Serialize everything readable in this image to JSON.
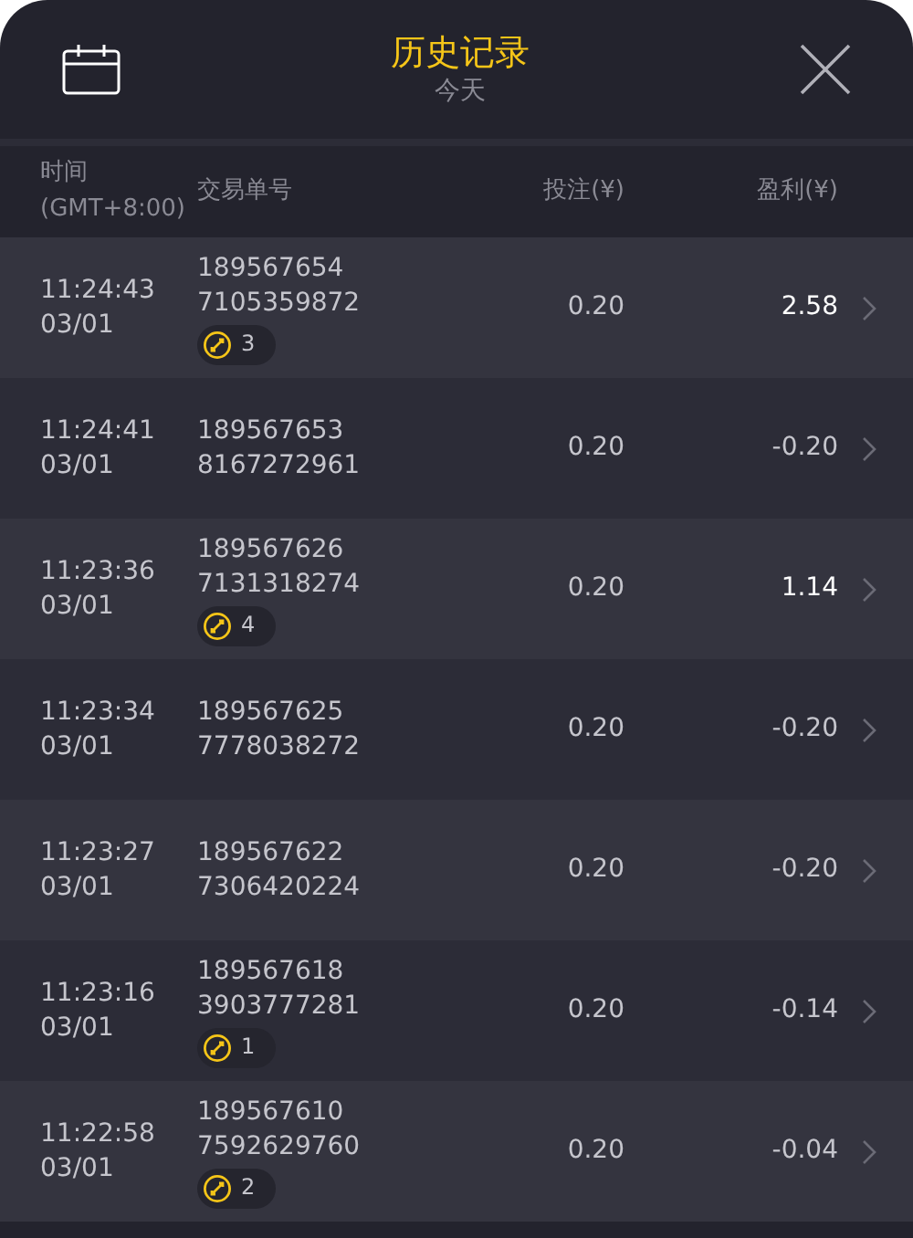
{
  "header": {
    "title": "历史记录",
    "subtitle": "今天"
  },
  "columns": {
    "time": "时间",
    "timezone": "(GMT+8:00)",
    "order": "交易单号",
    "bet": "投注(¥)",
    "profit": "盈利(¥)"
  },
  "rows": [
    {
      "time": "11:24:43",
      "date": "03/01",
      "order_1": "189567654",
      "order_2": "7105359872",
      "badge": "3",
      "bet": "0.20",
      "profit": "2.58",
      "win": true
    },
    {
      "time": "11:24:41",
      "date": "03/01",
      "order_1": "189567653",
      "order_2": "8167272961",
      "bet": "0.20",
      "profit": "-0.20",
      "win": false
    },
    {
      "time": "11:23:36",
      "date": "03/01",
      "order_1": "189567626",
      "order_2": "7131318274",
      "badge": "4",
      "bet": "0.20",
      "profit": "1.14",
      "win": true
    },
    {
      "time": "11:23:34",
      "date": "03/01",
      "order_1": "189567625",
      "order_2": "7778038272",
      "bet": "0.20",
      "profit": "-0.20",
      "win": false
    },
    {
      "time": "11:23:27",
      "date": "03/01",
      "order_1": "189567622",
      "order_2": "7306420224",
      "bet": "0.20",
      "profit": "-0.20",
      "win": false
    },
    {
      "time": "11:23:16",
      "date": "03/01",
      "order_1": "189567618",
      "order_2": "3903777281",
      "badge": "1",
      "bet": "0.20",
      "profit": "-0.14",
      "win": false
    },
    {
      "time": "11:22:58",
      "date": "03/01",
      "order_1": "189567610",
      "order_2": "7592629760",
      "badge": "2",
      "bet": "0.20",
      "profit": "-0.04",
      "win": false
    }
  ]
}
